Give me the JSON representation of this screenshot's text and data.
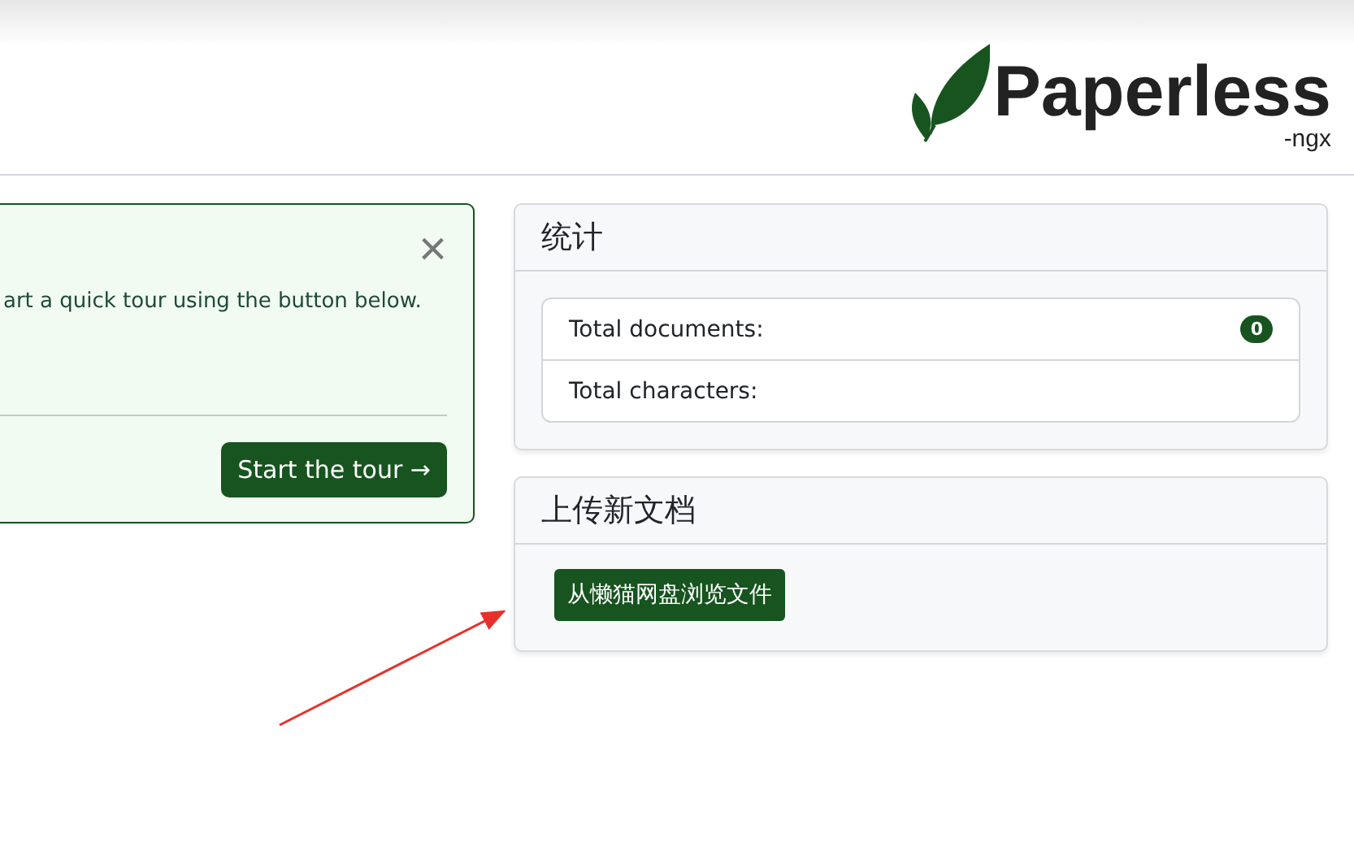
{
  "header": {
    "logo_text": "Paperless",
    "logo_sub": "-ngx"
  },
  "welcome": {
    "text": "art a quick tour using the button below.",
    "close": "×",
    "button": "Start the tour →"
  },
  "stats": {
    "title": "统计",
    "rows": [
      {
        "label": "Total documents:",
        "badge": "0"
      },
      {
        "label": "Total characters:"
      }
    ]
  },
  "upload": {
    "title": "上传新文档",
    "button": "从懒猫网盘浏览文件"
  }
}
